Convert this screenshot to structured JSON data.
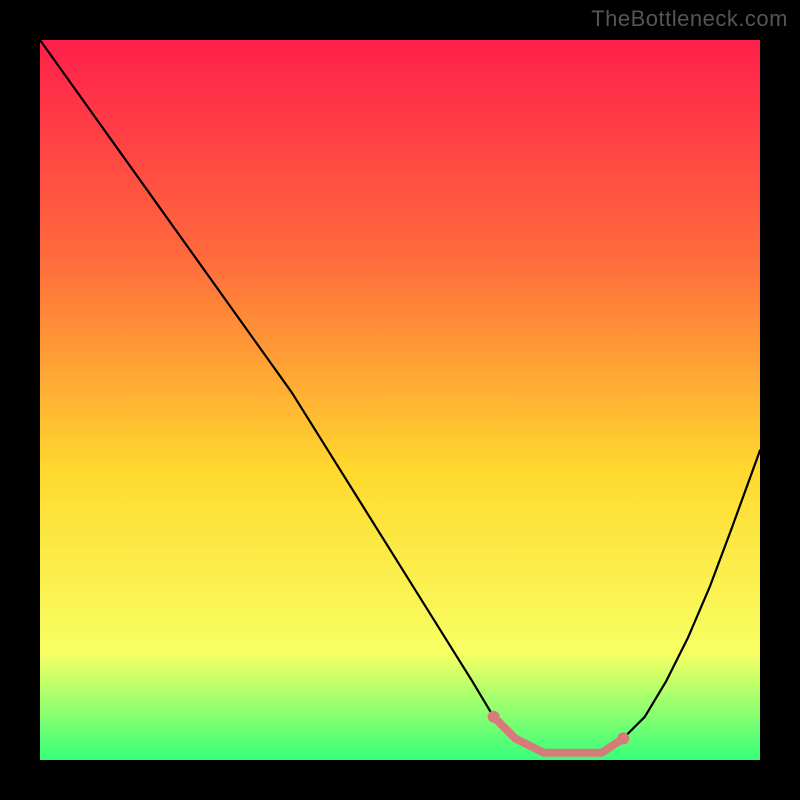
{
  "watermark": "TheBottleneck.com",
  "chart_data": {
    "type": "line",
    "title": "",
    "xlabel": "",
    "ylabel": "",
    "x_range": [
      0,
      100
    ],
    "y_range": [
      0,
      100
    ],
    "grid": false,
    "gradient": {
      "top": "#ff1f4b",
      "mid_upper": "#ff6a3c",
      "mid": "#ffd92e",
      "mid_lower": "#f8ff63",
      "bottom": "#36ff7a"
    },
    "series": [
      {
        "name": "curve",
        "stroke": "#000000",
        "x": [
          0,
          5,
          10,
          15,
          20,
          25,
          30,
          35,
          40,
          45,
          50,
          55,
          60,
          63,
          66,
          70,
          74,
          78,
          81,
          84,
          87,
          90,
          93,
          96,
          100
        ],
        "y": [
          100,
          93,
          86,
          79,
          72,
          65,
          58,
          51,
          43,
          35,
          27,
          19,
          11,
          6,
          3,
          1,
          1,
          1,
          3,
          6,
          11,
          17,
          24,
          32,
          43
        ]
      },
      {
        "name": "highlight",
        "stroke": "#d67a7a",
        "thickness": 8,
        "x": [
          63,
          66,
          70,
          74,
          78,
          81
        ],
        "y": [
          6,
          3,
          1,
          1,
          1,
          3
        ]
      }
    ],
    "markers": [
      {
        "x": 63,
        "y": 6,
        "color": "#d67a7a",
        "r": 6
      },
      {
        "x": 81,
        "y": 3,
        "color": "#d67a7a",
        "r": 6
      }
    ]
  }
}
